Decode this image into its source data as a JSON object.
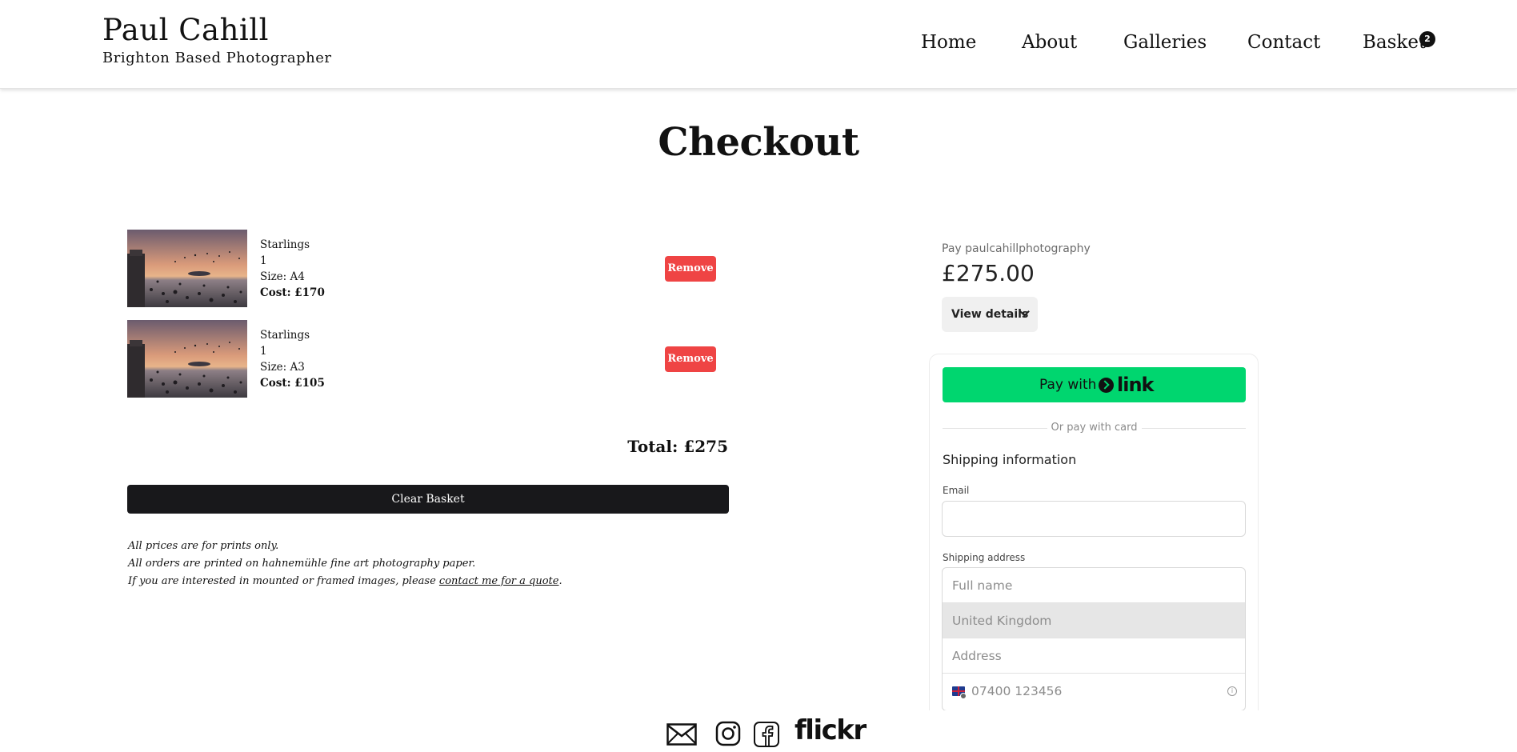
{
  "header": {
    "brand_title": "Paul Cahill",
    "brand_subtitle": "Brighton Based Photographer",
    "nav": {
      "home": "Home",
      "about": "About",
      "galleries": "Galleries",
      "contact": "Contact",
      "basket": "Basket"
    },
    "basket_count": "2"
  },
  "page_title": "Checkout",
  "basket": {
    "items": [
      {
        "name": "Starlings",
        "quantity": "1",
        "size": "Size: A4",
        "cost": "Cost: £170",
        "remove_label": "Remove"
      },
      {
        "name": "Starlings",
        "quantity": "1",
        "size": "Size: A3",
        "cost": "Cost: £105",
        "remove_label": "Remove"
      }
    ],
    "total": "Total: £275",
    "clear_label": "Clear Basket"
  },
  "notes": {
    "line1": "All prices are for prints only.",
    "line2": "All orders are printed on hahnemühle fine art photography paper.",
    "line3_prefix": "If you are interested in mounted or framed images, please ",
    "line3_link": "contact me for a quote",
    "line3_suffix": "."
  },
  "payment": {
    "pay_to": "Pay paulcahillphotography",
    "amount": "£275.00",
    "view_details": "View details",
    "pay_with": "Pay with",
    "link_word": "link",
    "or_pay_card": "Or pay with card",
    "shipping_heading": "Shipping information",
    "email_label": "Email",
    "address_label": "Shipping address",
    "full_name_placeholder": "Full name",
    "country_value": "United Kingdom",
    "address_placeholder": "Address",
    "phone_placeholder": "07400 123456"
  },
  "footer": {
    "flickr_label": "flickr"
  },
  "colors": {
    "remove": "#ef4444",
    "clear_button": "#18181b",
    "link_green": "#00d66f"
  }
}
